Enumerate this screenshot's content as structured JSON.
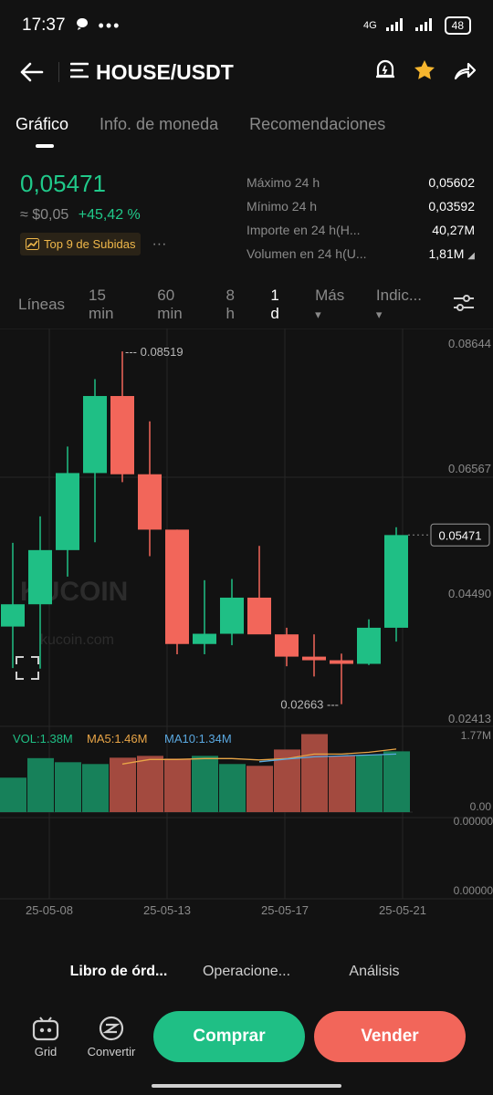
{
  "status_bar": {
    "time": "17:37",
    "network": "4G",
    "battery": "48"
  },
  "header": {
    "title": "HOUSE/USDT"
  },
  "tabs": [
    {
      "label": "Gráfico",
      "active": true
    },
    {
      "label": "Info. de moneda",
      "active": false
    },
    {
      "label": "Recomendaciones",
      "active": false
    }
  ],
  "ticker": {
    "last_price": "0,05471",
    "fiat_price": "≈ $0,05",
    "change": "+45,42 %",
    "rank_badge": "Top 9 de Subidas",
    "rank_more": "···"
  },
  "stats": [
    {
      "label": "Máximo 24 h",
      "value": "0,05602"
    },
    {
      "label": "Mínimo 24 h",
      "value": "0,03592"
    },
    {
      "label": "Importe en 24 h(H...",
      "value": "40,27M"
    },
    {
      "label": "Volumen en 24 h(U...",
      "value": "1,81M"
    }
  ],
  "intervals": [
    {
      "label": "Líneas",
      "active": false,
      "dropdown": false
    },
    {
      "label": "15 min",
      "active": false,
      "dropdown": false
    },
    {
      "label": "60 min",
      "active": false,
      "dropdown": false
    },
    {
      "label": "8 h",
      "active": false,
      "dropdown": false
    },
    {
      "label": "1 d",
      "active": true,
      "dropdown": false
    },
    {
      "label": "Más",
      "active": false,
      "dropdown": true
    },
    {
      "label": "Indic...",
      "active": false,
      "dropdown": true
    }
  ],
  "chart_data": {
    "type": "candlestick",
    "y_axis_labels": [
      "0.08644",
      "0.06567",
      "0.04490",
      "0.02413"
    ],
    "price_range": [
      0.02413,
      0.08644
    ],
    "last_price_label": "0.05471",
    "last_price_value": 0.05471,
    "high_marker": {
      "label": "--- 0.08519",
      "value": 0.08519
    },
    "low_marker": {
      "label": "0.02663 ---",
      "value": 0.02663
    },
    "x_axis_labels": [
      "25-05-08",
      "25-05-13",
      "25-05-17",
      "25-05-21"
    ],
    "watermark": {
      "brand": "KUCOIN",
      "site": "kucoin.com"
    },
    "candles": [
      {
        "o": 0.0395,
        "h": 0.0534,
        "l": 0.0326,
        "c": 0.0432
      },
      {
        "o": 0.0432,
        "h": 0.0578,
        "l": 0.0325,
        "c": 0.0522
      },
      {
        "o": 0.0522,
        "h": 0.0694,
        "l": 0.0478,
        "c": 0.065
      },
      {
        "o": 0.065,
        "h": 0.0806,
        "l": 0.0535,
        "c": 0.0778
      },
      {
        "o": 0.0778,
        "h": 0.0852,
        "l": 0.0635,
        "c": 0.0648
      },
      {
        "o": 0.0648,
        "h": 0.0736,
        "l": 0.0512,
        "c": 0.0556
      },
      {
        "o": 0.0556,
        "h": 0.0556,
        "l": 0.0349,
        "c": 0.0366
      },
      {
        "o": 0.0366,
        "h": 0.0472,
        "l": 0.0349,
        "c": 0.0383
      },
      {
        "o": 0.0383,
        "h": 0.0474,
        "l": 0.0364,
        "c": 0.0443
      },
      {
        "o": 0.0443,
        "h": 0.0529,
        "l": 0.0388,
        "c": 0.0382
      },
      {
        "o": 0.0382,
        "h": 0.0393,
        "l": 0.0329,
        "c": 0.0345
      },
      {
        "o": 0.0345,
        "h": 0.0382,
        "l": 0.0312,
        "c": 0.0339
      },
      {
        "o": 0.0339,
        "h": 0.035,
        "l": 0.0266,
        "c": 0.0333
      },
      {
        "o": 0.0333,
        "h": 0.0407,
        "l": 0.0331,
        "c": 0.0393
      },
      {
        "o": 0.0393,
        "h": 0.056,
        "l": 0.037,
        "c": 0.0547
      }
    ],
    "volume_indicators": {
      "vol": "VOL:1.38M",
      "ma5": "MA5:1.46M",
      "ma10": "MA10:1.34M"
    },
    "volume_axis_labels": {
      "top": "1.77M",
      "bottom": "0.00"
    },
    "volume_max": 1.77,
    "volumes": [
      0.76,
      1.19,
      1.1,
      1.06,
      1.2,
      1.24,
      1.18,
      1.24,
      1.06,
      1.02,
      1.38,
      1.72,
      1.24,
      1.26,
      1.34
    ],
    "ma5": [
      null,
      null,
      null,
      null,
      1.06,
      1.16,
      1.16,
      1.18,
      1.18,
      1.15,
      1.18,
      1.28,
      1.28,
      1.32,
      1.39
    ],
    "ma10": [
      null,
      null,
      null,
      null,
      null,
      null,
      null,
      null,
      null,
      1.11,
      1.17,
      1.22,
      1.24,
      1.26,
      1.28
    ],
    "indicator_axis_labels": [
      "0.00000",
      "0.00000"
    ]
  },
  "bottom_tabs": [
    {
      "label": "Libro de órd...",
      "active": true
    },
    {
      "label": "Operacione...",
      "active": false
    },
    {
      "label": "Análisis",
      "active": false
    }
  ],
  "actions": {
    "grid_label": "Grid",
    "convert_label": "Convertir",
    "buy_label": "Comprar",
    "sell_label": "Vender"
  },
  "colors": {
    "up": "#1fbf85",
    "down": "#f2665a",
    "vol_up": "#17815a",
    "vol_down": "#a34a3f",
    "ma5": "#e8a547",
    "ma10": "#5aa8e0",
    "badge": "#f0b84a"
  }
}
